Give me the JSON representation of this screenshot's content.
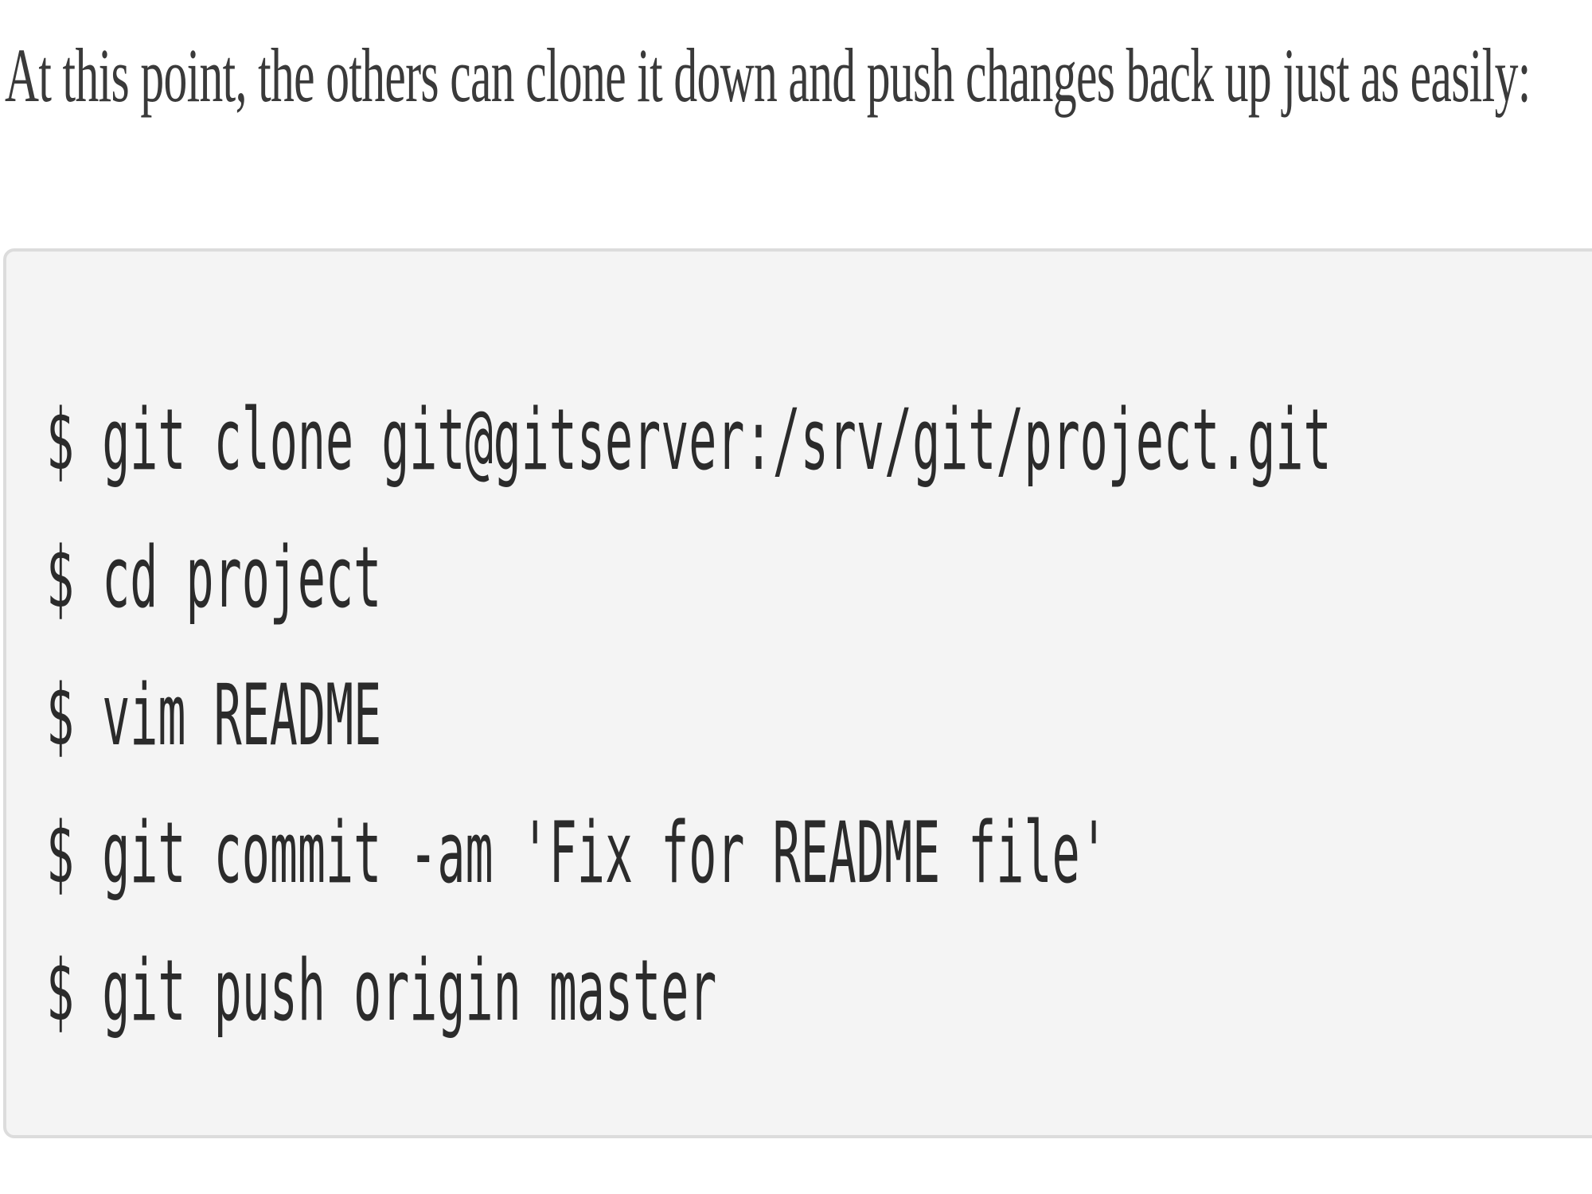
{
  "intro_text": "At this point, the others can clone it down and push changes back up just as easily:",
  "code": {
    "lines": [
      "$ git clone git@gitserver:/srv/git/project.git",
      "$ cd project",
      "$ vim README",
      "$ git commit -am 'Fix for README file'",
      "$ git push origin master"
    ]
  }
}
